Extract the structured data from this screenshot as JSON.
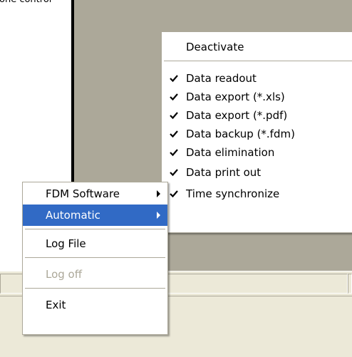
{
  "background": {
    "cut_text": "one control"
  },
  "main_menu": {
    "items": [
      {
        "label": "FDM Software",
        "has_submenu": true,
        "highlighted": false,
        "disabled": false
      },
      {
        "label": "Automatic",
        "has_submenu": true,
        "highlighted": true,
        "disabled": false
      },
      {
        "label": "Log File",
        "has_submenu": false,
        "highlighted": false,
        "disabled": false
      },
      {
        "label": "Log off",
        "has_submenu": false,
        "highlighted": false,
        "disabled": true
      },
      {
        "label": "Exit",
        "has_submenu": false,
        "highlighted": false,
        "disabled": false
      }
    ]
  },
  "automatic_submenu": {
    "deactivate_label": "Deactivate",
    "items": [
      {
        "label": "Data readout",
        "checked": true
      },
      {
        "label": "Data export (*.xls)",
        "checked": true
      },
      {
        "label": "Data export (*.pdf)",
        "checked": true
      },
      {
        "label": "Data backup (*.fdm)",
        "checked": true
      },
      {
        "label": "Data elimination",
        "checked": true
      },
      {
        "label": "Data print out",
        "checked": true
      },
      {
        "label": "Time synchronize",
        "checked": true
      }
    ]
  },
  "colors": {
    "highlight": "#316ac5",
    "background": "#ece9d8",
    "workspace": "#aca899"
  }
}
